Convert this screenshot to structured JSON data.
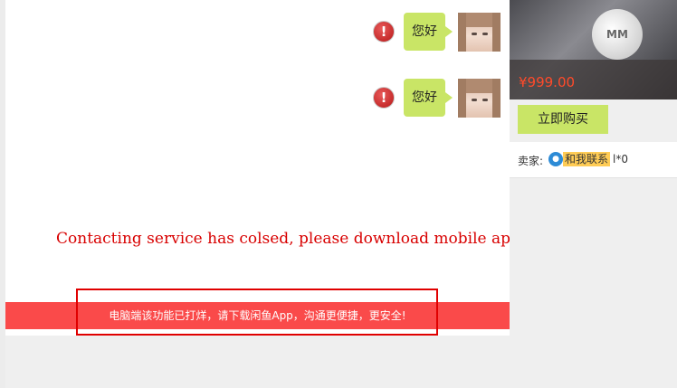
{
  "chat": {
    "messages": [
      {
        "text": "您好",
        "status_icon": "exclamation-icon",
        "status_glyph": "!"
      },
      {
        "text": "您好",
        "status_icon": "exclamation-icon",
        "status_glyph": "!"
      }
    ],
    "overlay_notice": "Contacting service has colsed, please download mobile app.",
    "bottom_notice": "电脑端该功能已打烊，请下载闲鱼App，沟通更便捷，更安全!"
  },
  "product": {
    "image_brand": "MM",
    "price": "¥999.00",
    "buy_label": "立即购买"
  },
  "seller": {
    "label": "卖家:",
    "ww_icon": "aliwangwang-icon",
    "contact_label": "和我联系",
    "name": "l*0"
  },
  "colors": {
    "bubble": "#c9e566",
    "notice_bar": "#fa4a4a",
    "price": "#ff4a2a",
    "outline": "#e00000"
  }
}
